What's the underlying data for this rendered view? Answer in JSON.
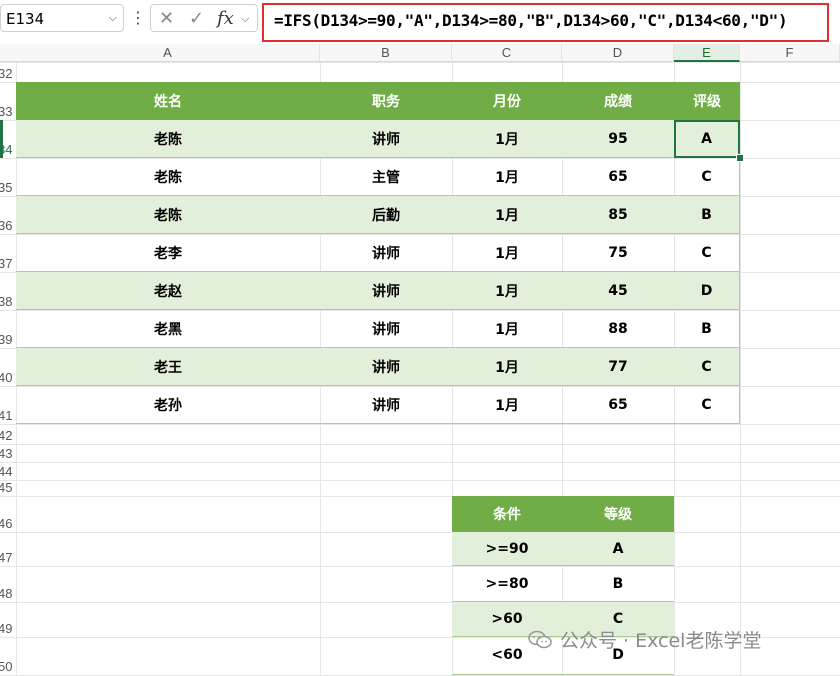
{
  "name_box": {
    "value": "E134"
  },
  "formula_bar": {
    "cancel_icon": "✕",
    "enter_icon": "✓",
    "fx_icon": "fx",
    "formula": "=IFS(D134>=90,\"A\",D134>=80,\"B\",D134>60,\"C\",D134<60,\"D\")"
  },
  "columns": [
    "A",
    "B",
    "C",
    "D",
    "E",
    "F"
  ],
  "selected_column": "E",
  "row_numbers": [
    "32",
    "33",
    "34",
    "35",
    "36",
    "37",
    "38",
    "39",
    "40",
    "41",
    "42",
    "43",
    "44",
    "45",
    "46",
    "47",
    "48",
    "49",
    "50"
  ],
  "selected_row": "34",
  "main_table": {
    "headers": [
      "姓名",
      "职务",
      "月份",
      "成绩",
      "评级"
    ],
    "rows": [
      [
        "老陈",
        "讲师",
        "1月",
        "95",
        "A"
      ],
      [
        "老陈",
        "主管",
        "1月",
        "65",
        "C"
      ],
      [
        "老陈",
        "后勤",
        "1月",
        "85",
        "B"
      ],
      [
        "老李",
        "讲师",
        "1月",
        "75",
        "C"
      ],
      [
        "老赵",
        "讲师",
        "1月",
        "45",
        "D"
      ],
      [
        "老黑",
        "讲师",
        "1月",
        "88",
        "B"
      ],
      [
        "老王",
        "讲师",
        "1月",
        "77",
        "C"
      ],
      [
        "老孙",
        "讲师",
        "1月",
        "65",
        "C"
      ]
    ]
  },
  "criteria_table": {
    "headers": [
      "条件",
      "等级"
    ],
    "rows": [
      [
        ">=90",
        "A"
      ],
      [
        ">=80",
        "B"
      ],
      [
        ">60",
        "C"
      ],
      [
        "<60",
        "D"
      ]
    ]
  },
  "colors": {
    "header_green": "#70ad47",
    "band_green": "#e2efda",
    "selection": "#217346",
    "formula_border": "#e03131"
  },
  "watermark": {
    "text": "公众号 · Excel老陈学堂"
  }
}
